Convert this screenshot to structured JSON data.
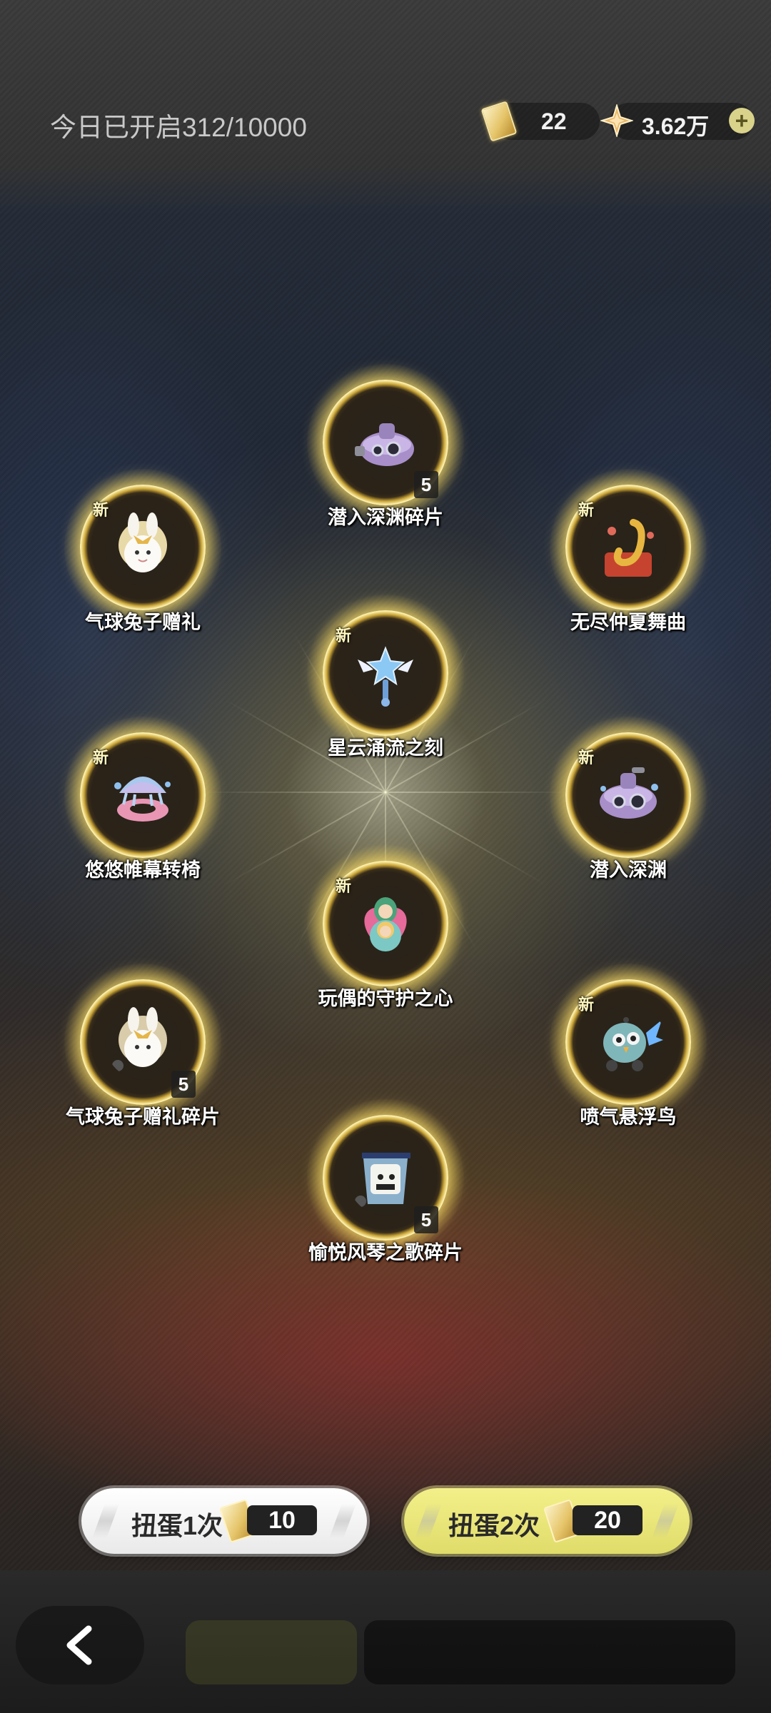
{
  "header": {
    "opened_today": "今日已开启312/10000",
    "ticket_count": "22",
    "shard_count": "3.62万",
    "add_icon": "plus-icon",
    "ticket_icon": "ticket-icon",
    "shard_icon": "star-shard-icon"
  },
  "prizes": [
    {
      "name": "潜入深渊碎片",
      "is_new": false,
      "count": "5"
    },
    {
      "name": "气球兔子赠礼",
      "is_new": true,
      "new_label": "新",
      "count": ""
    },
    {
      "name": "无尽仲夏舞曲",
      "is_new": true,
      "new_label": "新",
      "count": ""
    },
    {
      "name": "星云涌流之刻",
      "is_new": true,
      "new_label": "新",
      "count": ""
    },
    {
      "name": "悠悠帷幕转椅",
      "is_new": true,
      "new_label": "新",
      "count": ""
    },
    {
      "name": "潜入深渊",
      "is_new": true,
      "new_label": "新",
      "count": ""
    },
    {
      "name": "玩偶的守护之心",
      "is_new": true,
      "new_label": "新",
      "count": ""
    },
    {
      "name": "气球兔子赠礼碎片",
      "is_new": false,
      "count": "5"
    },
    {
      "name": "喷气悬浮鸟",
      "is_new": true,
      "new_label": "新",
      "count": ""
    },
    {
      "name": "愉悦风琴之歌碎片",
      "is_new": false,
      "count": "5"
    }
  ],
  "actions": {
    "gacha_once_label": "扭蛋1次",
    "gacha_once_cost": "10",
    "gacha_twice_label": "扭蛋2次",
    "gacha_twice_cost": "20",
    "back_icon": "chevron-left-icon"
  },
  "colors": {
    "badge_gold": "#e7c34a",
    "once_button": "#ffffff",
    "twice_button": "#ece879"
  }
}
